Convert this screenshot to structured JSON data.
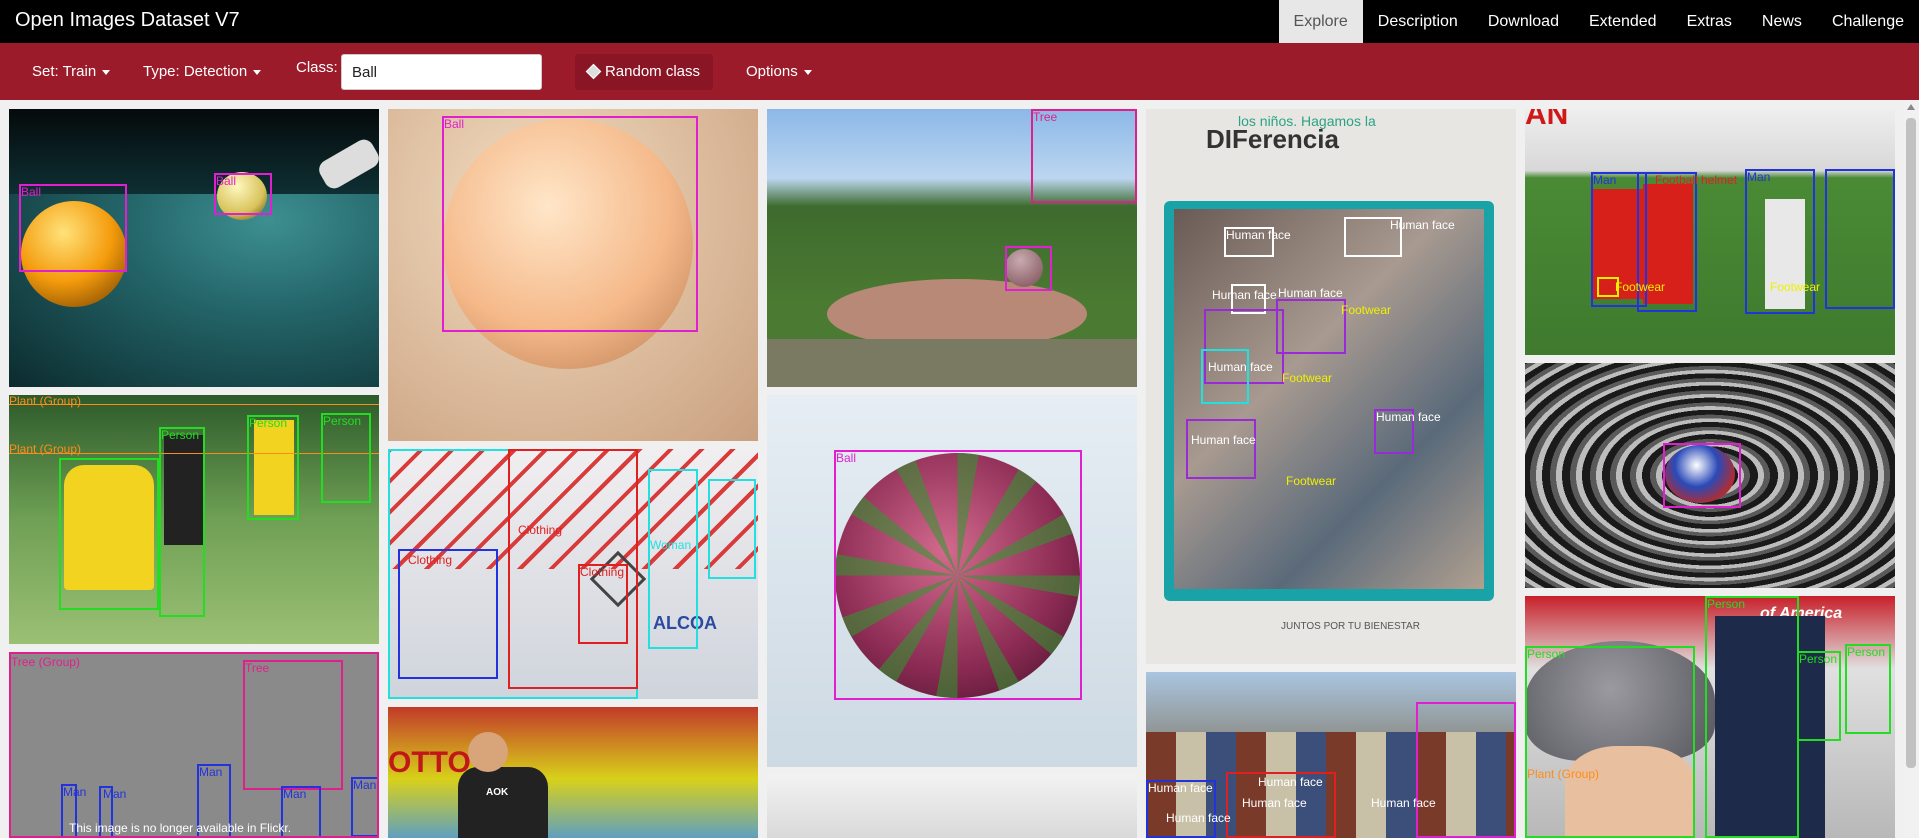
{
  "app": {
    "title": "Open Images Dataset V7"
  },
  "nav": [
    {
      "label": "Explore",
      "active": true
    },
    {
      "label": "Description"
    },
    {
      "label": "Download"
    },
    {
      "label": "Extended"
    },
    {
      "label": "Extras"
    },
    {
      "label": "News"
    },
    {
      "label": "Challenge"
    }
  ],
  "toolbar": {
    "set_label": "Set: Train",
    "type_label": "Type: Detection",
    "class_label": "Class:",
    "class_value": "Ball",
    "random_label": "Random class",
    "options_label": "Options"
  },
  "images": [
    {
      "labels": [
        "Ball",
        "Ball"
      ]
    },
    {
      "labels": [
        "Ball"
      ]
    },
    {
      "labels": [
        "Tree"
      ]
    },
    {
      "text_sign": [
        "los niños. Hagamos la",
        "DIFerencia",
        "JUNTOS POR TU BIENESTAR"
      ],
      "labels": [
        "Human face",
        "Human face",
        "Human face",
        "Human face",
        "Footwear",
        "Footwear",
        "Footwear",
        "Human face",
        "Human face",
        "Human face"
      ]
    },
    {
      "text_sign": [
        "AN"
      ],
      "labels": [
        "Man",
        "Football helmet",
        "Man",
        "Footwear",
        "Footwear"
      ]
    },
    {
      "labels": [
        "Plant (Group)",
        "Plant (Group)",
        "Person",
        "Person",
        "Person",
        "Person"
      ]
    },
    {
      "text_sign": [
        "ALCOA"
      ],
      "labels": [
        "Woman",
        "Clothing",
        "Clothing",
        "Clothing"
      ]
    },
    {
      "labels": [
        "Ball"
      ]
    },
    {
      "labels": []
    },
    {
      "labels": [
        "Tree (Group)",
        "Tree",
        "Man",
        "Man",
        "Man",
        "Man",
        "Man"
      ],
      "notice": "This image is no longer available in Flickr."
    },
    {
      "text_sign": [
        "OTTO",
        "AOK"
      ],
      "labels": []
    },
    {
      "labels": []
    },
    {
      "labels": [
        "Human face",
        "Human face",
        "Human face",
        "Human face",
        "Human face"
      ]
    },
    {
      "text_sign": [
        "of America"
      ],
      "labels": [
        "Person",
        "Person",
        "Person",
        "Person",
        "Plant (Group)"
      ]
    }
  ],
  "colors": {
    "topbar": "#000000",
    "toolbar": "#9b1b2b",
    "magenta": "#e020d0",
    "green": "#22dd22",
    "blue": "#2233dd",
    "yellow": "#f0f000",
    "orange": "#ff8c1a",
    "cyan": "#22e0e0",
    "red": "#e02020",
    "white": "#ffffff"
  }
}
